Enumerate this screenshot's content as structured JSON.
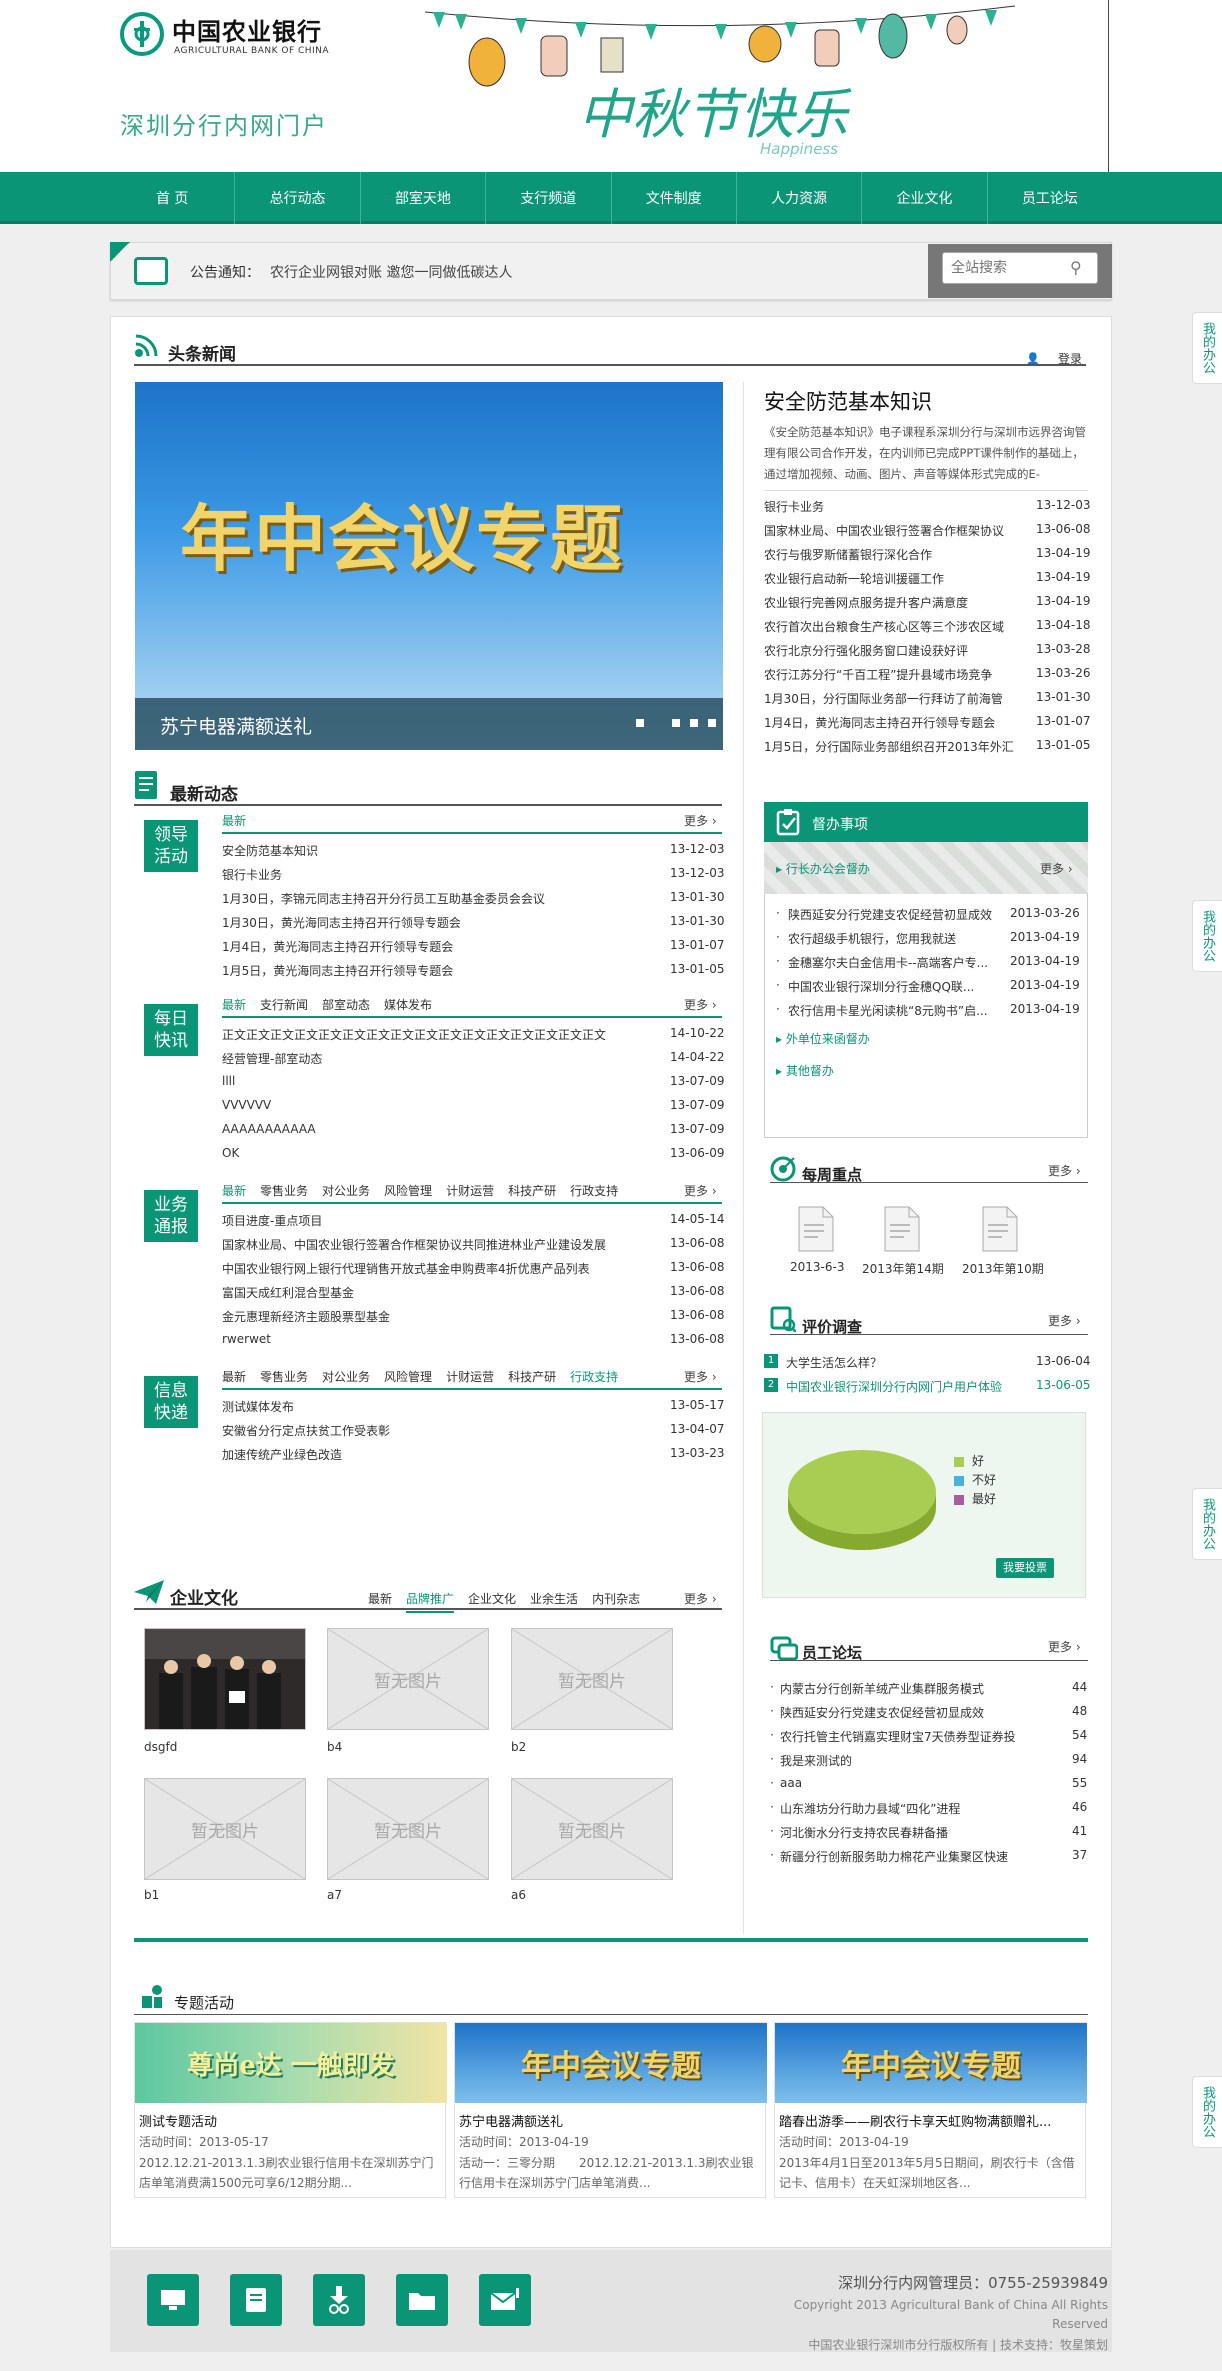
{
  "header": {
    "logo_mark": "ABC",
    "bank_name_cn": "中国农业银行",
    "bank_name_en": "AGRICULTURAL BANK OF CHINA",
    "portal_title": "深圳分行内网门户",
    "festival_text": "中秋节快乐",
    "festival_en": "Happiness"
  },
  "nav": [
    "首 页",
    "总行动态",
    "部室天地",
    "支行频道",
    "文件制度",
    "人力资源",
    "企业文化",
    "员工论坛"
  ],
  "notice": {
    "label": "公告通知：",
    "text": "农行企业网银对账 邀您一同做低碳达人"
  },
  "search": {
    "placeholder": "全站搜索"
  },
  "side_tab": "我的办公",
  "headline": {
    "title": "头条新闻",
    "login": "登录",
    "banner_text": "年中会议专题",
    "banner_caption": "苏宁电器满额送礼",
    "feature_title": "安全防范基本知识",
    "feature_desc": "《安全防范基本知识》电子课程系深圳分行与深圳市远界咨询管理有限公司合作开发，在内训师已完成PPT课件制作的基础上，通过增加视频、动画、图片、声音等媒体形式完成的E-",
    "items": [
      {
        "t": "银行卡业务",
        "d": "13-12-03"
      },
      {
        "t": "国家林业局、中国农业银行签署合作框架协议",
        "d": "13-06-08"
      },
      {
        "t": "农行与俄罗斯储蓄银行深化合作",
        "d": "13-04-19"
      },
      {
        "t": "农业银行启动新一轮培训援疆工作",
        "d": "13-04-19"
      },
      {
        "t": "农业银行完善网点服务提升客户满意度",
        "d": "13-04-19"
      },
      {
        "t": "农行首次出台粮食生产核心区等三个涉农区域",
        "d": "13-04-18"
      },
      {
        "t": "农行北京分行强化服务窗口建设获好评",
        "d": "13-03-28"
      },
      {
        "t": "农行江苏分行“千百工程”提升县域市场竞争",
        "d": "13-03-26"
      },
      {
        "t": "1月30日，分行国际业务部一行拜访了前海管",
        "d": "13-01-30"
      },
      {
        "t": "1月4日，黄光海同志主持召开行领导专题会",
        "d": "13-01-07"
      },
      {
        "t": "1月5日，分行国际业务部组织召开2013年外汇",
        "d": "13-01-05"
      }
    ]
  },
  "news": {
    "title": "最新动态",
    "more": "更多",
    "groups": [
      {
        "tag": "领导活动",
        "tabs": [
          "最新"
        ],
        "items": [
          {
            "t": "安全防范基本知识",
            "d": "13-12-03"
          },
          {
            "t": "银行卡业务",
            "d": "13-12-03"
          },
          {
            "t": "1月30日，李锦元同志主持召开分行员工互助基金委员会会议",
            "d": "13-01-30"
          },
          {
            "t": "1月30日，黄光海同志主持召开行领导专题会",
            "d": "13-01-30"
          },
          {
            "t": "1月4日，黄光海同志主持召开行领导专题会",
            "d": "13-01-07"
          },
          {
            "t": "1月5日，黄光海同志主持召开行领导专题会",
            "d": "13-01-05"
          }
        ]
      },
      {
        "tag": "每日快讯",
        "tabs": [
          "最新",
          "支行新闻",
          "部室动态",
          "媒体发布"
        ],
        "items": [
          {
            "t": "正文正文正文正文正文正文正文正文正文正文正文正文正文正文正文正文",
            "d": "14-10-22"
          },
          {
            "t": "经营管理-部室动态",
            "d": "14-04-22"
          },
          {
            "t": "llll",
            "d": "13-07-09"
          },
          {
            "t": "VVVVVV",
            "d": "13-07-09"
          },
          {
            "t": "AAAAAAAAAAA",
            "d": "13-07-09"
          },
          {
            "t": "OK",
            "d": "13-06-09"
          }
        ]
      },
      {
        "tag": "业务通报",
        "tabs": [
          "最新",
          "零售业务",
          "对公业务",
          "风险管理",
          "计财运营",
          "科技产研",
          "行政支持"
        ],
        "items": [
          {
            "t": "项目进度-重点项目",
            "d": "14-05-14"
          },
          {
            "t": "国家林业局、中国农业银行签署合作框架协议共同推进林业产业建设发展",
            "d": "13-06-08"
          },
          {
            "t": "中国农业银行网上银行代理销售开放式基金申购费率4折优惠产品列表",
            "d": "13-06-08"
          },
          {
            "t": "富国天成红利混合型基金",
            "d": "13-06-08"
          },
          {
            "t": "金元惠理新经济主题股票型基金",
            "d": "13-06-08"
          },
          {
            "t": "rwerwet",
            "d": "13-06-08"
          }
        ]
      },
      {
        "tag": "信息快递",
        "tabs": [
          "最新",
          "零售业务",
          "对公业务",
          "风险管理",
          "计财运营",
          "科技产研",
          "行政支持"
        ],
        "items": [
          {
            "t": "测试媒体发布",
            "d": "13-05-17"
          },
          {
            "t": "安徽省分行定点扶贫工作受表彰",
            "d": "13-04-07"
          },
          {
            "t": "加速传统产业绿色改造",
            "d": "13-03-23"
          }
        ]
      }
    ]
  },
  "culture": {
    "title": "企业文化",
    "tabs": [
      "最新",
      "品牌推广",
      "企业文化",
      "业余生活",
      "内刊杂志"
    ],
    "more": "更多",
    "no_pic": "暂无图片",
    "items": [
      "dsgfd",
      "b4",
      "b2",
      "b1",
      "a7",
      "a6"
    ]
  },
  "supervise": {
    "title": "督办事项",
    "sub": "行长办公会督办",
    "more": "更多",
    "items": [
      {
        "t": "陕西延安分行党建支农促经营初显成效",
        "d": "2013-03-26"
      },
      {
        "t": "农行超级手机银行，您用我就送",
        "d": "2013-04-19"
      },
      {
        "t": "金穗塞尔夫白金信用卡--高端客户专...",
        "d": "2013-04-19"
      },
      {
        "t": "中国农业银行深圳分行金穗QQ联...",
        "d": "2013-04-19"
      },
      {
        "t": "农行信用卡星光闲读桃“8元购书”启...",
        "d": "2013-04-19"
      }
    ],
    "links": [
      "外单位来函督办",
      "其他督办"
    ]
  },
  "weekly": {
    "title": "每周重点",
    "more": "更多",
    "items": [
      "2013-6-3",
      "2013年第14期",
      "2013年第10期"
    ]
  },
  "survey": {
    "title": "评价调查",
    "more": "更多",
    "items": [
      {
        "n": "1",
        "t": "大学生活怎么样？",
        "d": "13-06-04"
      },
      {
        "n": "2",
        "t": "中国农业银行深圳分行内网门户用户体验",
        "d": "13-06-05"
      }
    ],
    "legend": [
      "好",
      "不好",
      "最好"
    ],
    "vote": "我要投票"
  },
  "chart_data": {
    "type": "pie",
    "categories": [
      "好",
      "不好",
      "最好"
    ],
    "values": [
      100,
      0,
      0
    ],
    "colors": [
      "#a9cd52",
      "#4bb1d8",
      "#a85d9e"
    ],
    "legend_position": "right"
  },
  "forum": {
    "title": "员工论坛",
    "more": "更多",
    "items": [
      {
        "t": "内蒙古分行创新羊绒产业集群服务模式",
        "n": "44"
      },
      {
        "t": "陕西延安分行党建支农促经营初显成效",
        "n": "48"
      },
      {
        "t": "农行托管主代销嘉实理财宝7天债券型证券投",
        "n": "54"
      },
      {
        "t": "我是来测试的",
        "n": "94"
      },
      {
        "t": "aaa",
        "n": "55"
      },
      {
        "t": "山东潍坊分行助力县域“四化”进程",
        "n": "46"
      },
      {
        "t": "河北衡水分行支持农民春耕备播",
        "n": "41"
      },
      {
        "t": "新疆分行创新服务助力棉花产业集聚区快速",
        "n": "37"
      }
    ]
  },
  "special": {
    "title": "专题活动",
    "cards": [
      {
        "img": "尊尚e达 一触即发",
        "title": "测试专题活动",
        "time": "活动时间：2013-05-17",
        "desc": "2012.12.21-2013.1.3刷农业银行信用卡在深圳苏宁门店单笔消费满1500元可享6/12期分期..."
      },
      {
        "img": "年中会议专题",
        "title": "苏宁电器满额送礼",
        "time": "活动时间：2013-04-19",
        "desc": "活动一：三零分期　　2012.12.21-2013.1.3刷农业银行信用卡在深圳苏宁门店单笔消费..."
      },
      {
        "img": "年中会议专题",
        "title": "踏春出游季——刷农行卡享天虹购物满额赠礼...",
        "time": "活动时间：2013-04-19",
        "desc": "2013年4月1日至2013年5月5日期间，刷农行卡（含借记卡、信用卡）在天虹深圳地区各..."
      }
    ]
  },
  "footer": {
    "admin": "深圳分行内网管理员：0755-25939849",
    "copyright": "Copyright 2013 Agricultural Bank of China All Rights Reserved",
    "support": "中国农业银行深圳市分行版权所有 | 技术支持：牧星策划",
    "icons": [
      "monitor-icon",
      "book-icon",
      "download-icon",
      "folder-icon",
      "mail-icon"
    ]
  }
}
